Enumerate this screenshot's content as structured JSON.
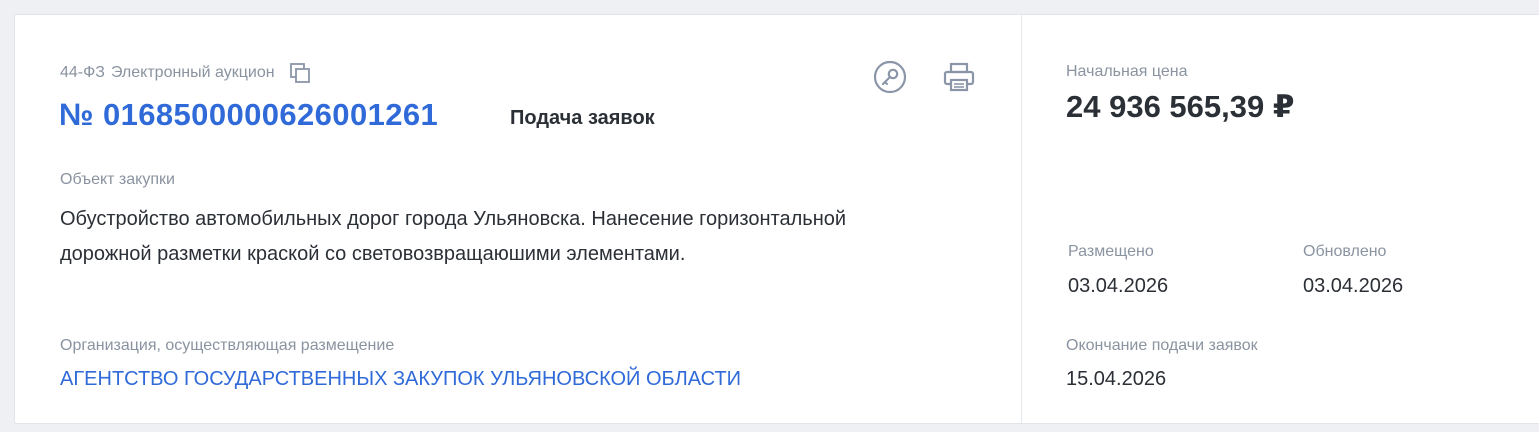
{
  "header": {
    "law": "44-ФЗ",
    "procedure_type": "Электронный аукцион",
    "number": "№ 0168500000626001261",
    "status": "Подача заявок"
  },
  "icons": {
    "copy": "copy-icon",
    "key": "key-icon",
    "print": "printer-icon"
  },
  "object": {
    "label": "Объект закупки",
    "text": "Обустройство автомобильных дорог города Ульяновска. Нанесение горизонтальной дорожной разметки краской со световозвращаюшими элементами."
  },
  "organization": {
    "label": "Организация, осуществляющая размещение",
    "name": "АГЕНТСТВО ГОСУДАРСТВЕННЫХ ЗАКУПОК УЛЬЯНОВСКОЙ ОБЛАСТИ"
  },
  "price": {
    "label": "Начальная цена",
    "value": "24 936 565,39 ₽"
  },
  "dates": {
    "placed_label": "Размещено",
    "placed_value": "03.04.2026",
    "updated_label": "Обновлено",
    "updated_value": "03.04.2026",
    "end_label": "Окончание подачи заявок",
    "end_value": "15.04.2026"
  },
  "colors": {
    "link": "#2f6ad8",
    "muted": "#8a93a0",
    "text": "#2b2f36",
    "icon": "#8a96a8"
  }
}
